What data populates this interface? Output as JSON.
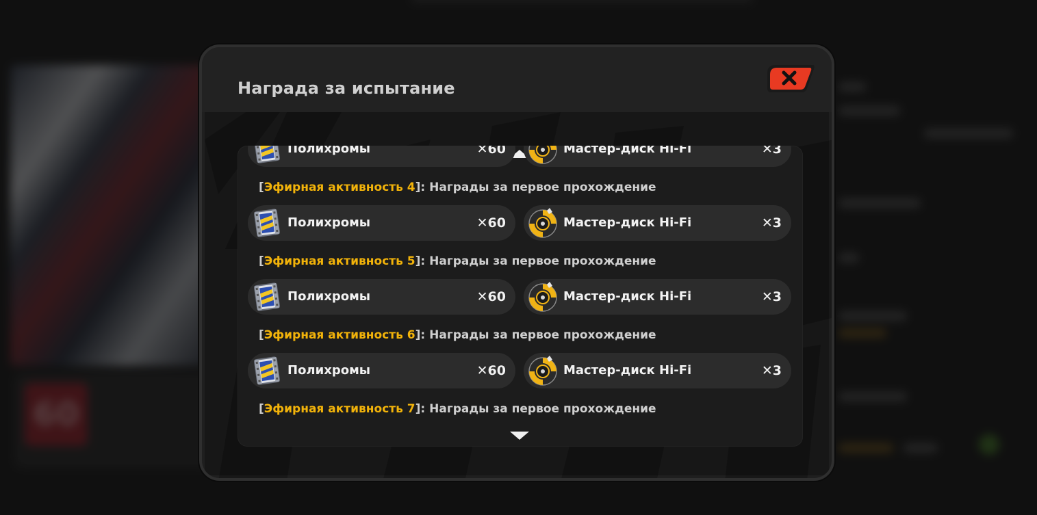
{
  "modal": {
    "title": "Награда за испытание",
    "close_icon": "close-x-icon"
  },
  "colors": {
    "highlight": "#f2b30a",
    "close_button": "#e83a22",
    "item_bg": "#2c2c2c"
  },
  "background": {
    "badge_number": "60"
  },
  "rows": [
    {
      "left_item": {
        "name": "Полихромы",
        "qty": "✕60",
        "icon": "polychrome-film-icon"
      },
      "right_item": {
        "name": "Мастер-диск Hi-Fi",
        "qty": "✕3",
        "icon": "hifi-master-disc-icon"
      },
      "caption": {
        "open": "[",
        "stage": "Эфирная активность 4",
        "close": "]: Награды за первое прохождение"
      }
    },
    {
      "left_item": {
        "name": "Полихромы",
        "qty": "✕60",
        "icon": "polychrome-film-icon"
      },
      "right_item": {
        "name": "Мастер-диск Hi-Fi",
        "qty": "✕3",
        "icon": "hifi-master-disc-icon"
      },
      "caption": {
        "open": "[",
        "stage": "Эфирная активность 5",
        "close": "]: Награды за первое прохождение"
      }
    },
    {
      "left_item": {
        "name": "Полихромы",
        "qty": "✕60",
        "icon": "polychrome-film-icon"
      },
      "right_item": {
        "name": "Мастер-диск Hi-Fi",
        "qty": "✕3",
        "icon": "hifi-master-disc-icon"
      },
      "caption": {
        "open": "[",
        "stage": "Эфирная активность 6",
        "close": "]: Награды за первое прохождение"
      }
    },
    {
      "left_item": {
        "name": "Полихромы",
        "qty": "✕60",
        "icon": "polychrome-film-icon"
      },
      "right_item": {
        "name": "Мастер-диск Hi-Fi",
        "qty": "✕3",
        "icon": "hifi-master-disc-icon"
      },
      "caption": {
        "open": "[",
        "stage": "Эфирная активность 7",
        "close": "]: Награды за первое прохождение"
      }
    }
  ],
  "scroll": {
    "up_icon": "scroll-up-arrow-icon",
    "down_icon": "scroll-down-arrow-icon"
  }
}
